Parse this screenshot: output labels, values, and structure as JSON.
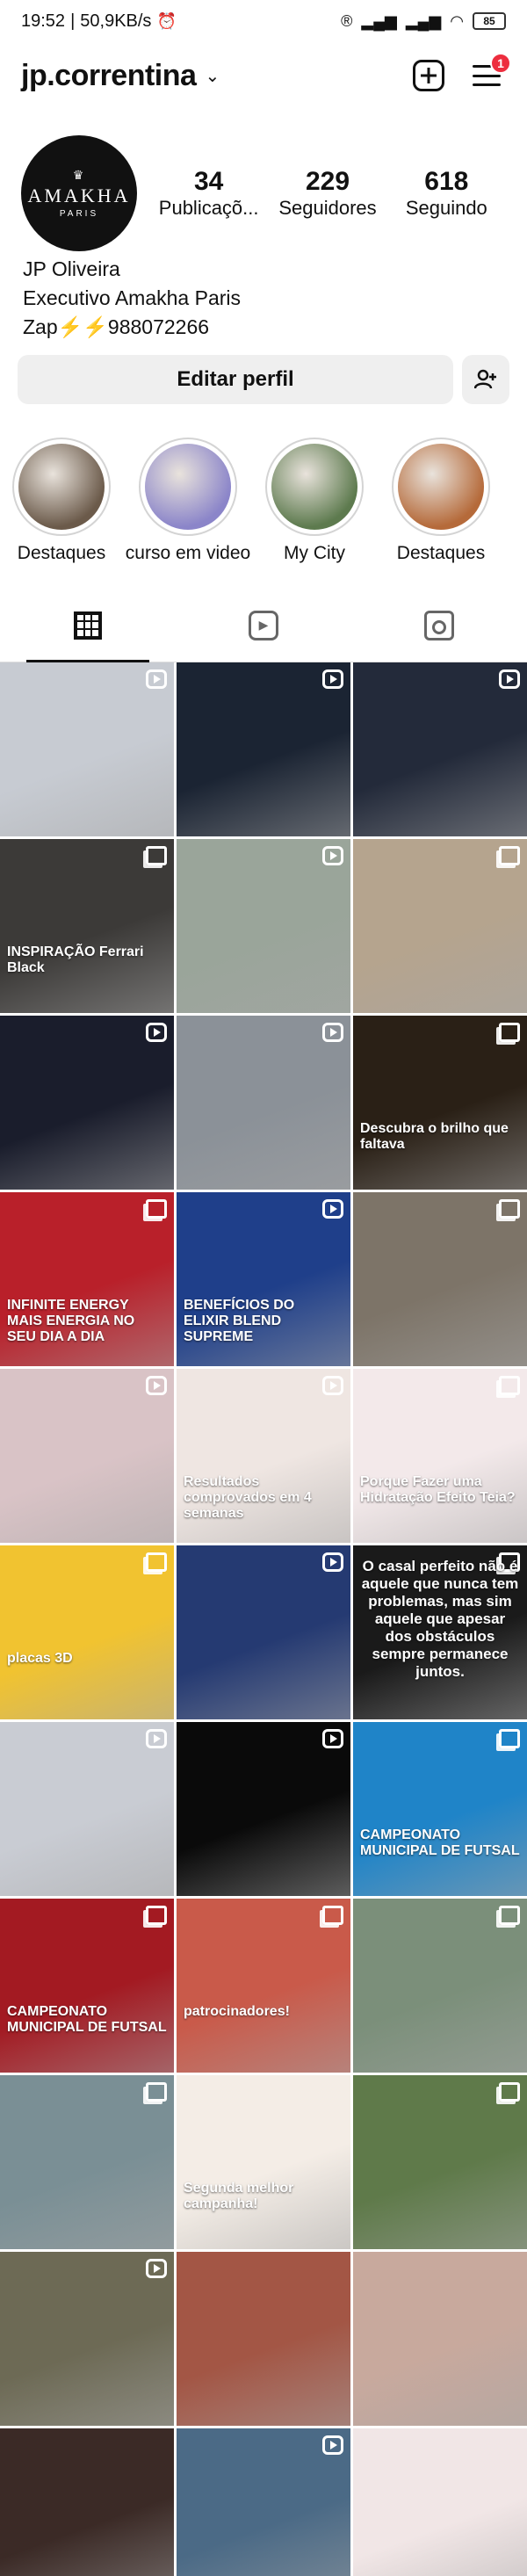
{
  "status_bar": {
    "time": "19:52",
    "speed": "50,9KB/s",
    "battery": "85"
  },
  "header": {
    "username": "jp.correntina",
    "notification_count": "1"
  },
  "profile": {
    "avatar": {
      "brand": "AMAKHA",
      "sub": "PARIS"
    },
    "stats": [
      {
        "value": "34",
        "label": "Publicaçõ..."
      },
      {
        "value": "229",
        "label": "Seguidores"
      },
      {
        "value": "618",
        "label": "Seguindo"
      }
    ],
    "name": "JP Oliveira",
    "bio_line": "Executivo Amakha Paris",
    "contact": "Zap⚡⚡988072266"
  },
  "actions": {
    "edit_label": "Editar perfil"
  },
  "highlights": [
    {
      "label": "Destaques",
      "color": "#6b5a4a"
    },
    {
      "label": "curso em video",
      "color": "#8b85c9"
    },
    {
      "label": "My City",
      "color": "#5d7a4e"
    },
    {
      "label": "Destaques",
      "color": "#b56a3a"
    }
  ],
  "tabs": [
    {
      "name": "grid",
      "icon": "grid-icon"
    },
    {
      "name": "reels",
      "icon": "reels-icon"
    },
    {
      "name": "tagged",
      "icon": "tagged-icon"
    }
  ],
  "grid_posts": [
    {
      "bg": "#c7cbd2",
      "mark": "reel",
      "caption": ""
    },
    {
      "bg": "#1b2433",
      "mark": "reel",
      "caption": ""
    },
    {
      "bg": "#232a3a",
      "mark": "reel",
      "caption": ""
    },
    {
      "bg": "#3c3a38",
      "mark": "multi",
      "caption": "INSPIRAÇÃO Ferrari Black"
    },
    {
      "bg": "#9aa59a",
      "mark": "reel",
      "caption": ""
    },
    {
      "bg": "#b5a48e",
      "mark": "multi",
      "caption": ""
    },
    {
      "bg": "#1a1d2c",
      "mark": "reel",
      "caption": ""
    },
    {
      "bg": "#8b9198",
      "mark": "reel",
      "caption": ""
    },
    {
      "bg": "#2a2016",
      "mark": "multi",
      "caption": "Descubra o brilho que faltava"
    },
    {
      "bg": "#b9202a",
      "mark": "multi",
      "caption": "INFINITE ENERGY MAIS ENERGIA NO SEU DIA A DIA"
    },
    {
      "bg": "#1f3f8a",
      "mark": "reel",
      "caption": "BENEFÍCIOS DO ELIXIR BLEND SUPREME"
    },
    {
      "bg": "#7d7468",
      "mark": "multi",
      "caption": ""
    },
    {
      "bg": "#d9c3c6",
      "mark": "reel",
      "caption": ""
    },
    {
      "bg": "#efe6e2",
      "mark": "reel",
      "caption": "Resultados comprovados em 4 semanas"
    },
    {
      "bg": "#f3e9ea",
      "mark": "multi",
      "caption": "Porque Fazer uma Hidratação Efeito Teia?"
    },
    {
      "bg": "#f1c330",
      "mark": "multi",
      "caption": "placas 3D"
    },
    {
      "bg": "#253a72",
      "mark": "reel",
      "caption": ""
    },
    {
      "bg": "#1a1a1a",
      "mark": "multi",
      "caption": "O casal perfeito não é aquele que nunca tem problemas, mas sim aquele que apesar dos obstáculos sempre permanece juntos."
    },
    {
      "bg": "#c9ccd3",
      "mark": "reel",
      "caption": ""
    },
    {
      "bg": "#0a0a0a",
      "mark": "reel",
      "caption": ""
    },
    {
      "bg": "#1f84c8",
      "mark": "multi",
      "caption": "CAMPEONATO MUNICIPAL DE FUTSAL"
    },
    {
      "bg": "#a31a22",
      "mark": "multi",
      "caption": "CAMPEONATO MUNICIPAL DE FUTSAL"
    },
    {
      "bg": "#c95a4a",
      "mark": "multi",
      "caption": "patrocinadores!"
    },
    {
      "bg": "#7b8f7a",
      "mark": "multi",
      "caption": ""
    },
    {
      "bg": "#7a8f95",
      "mark": "multi",
      "caption": ""
    },
    {
      "bg": "#f4ede6",
      "mark": "none",
      "caption": "Segunda melhor campanha!"
    },
    {
      "bg": "#5f7a4a",
      "mark": "multi",
      "caption": ""
    },
    {
      "bg": "#6d6a55",
      "mark": "reel",
      "caption": ""
    },
    {
      "bg": "#a35645",
      "mark": "none",
      "caption": ""
    },
    {
      "bg": "#c8a99d",
      "mark": "none",
      "caption": ""
    },
    {
      "bg": "#3b2a26",
      "mark": "none",
      "caption": ""
    },
    {
      "bg": "#4b6a86",
      "mark": "reel",
      "caption": ""
    },
    {
      "bg": "#f1e6e6",
      "mark": "none",
      "caption": ""
    }
  ]
}
